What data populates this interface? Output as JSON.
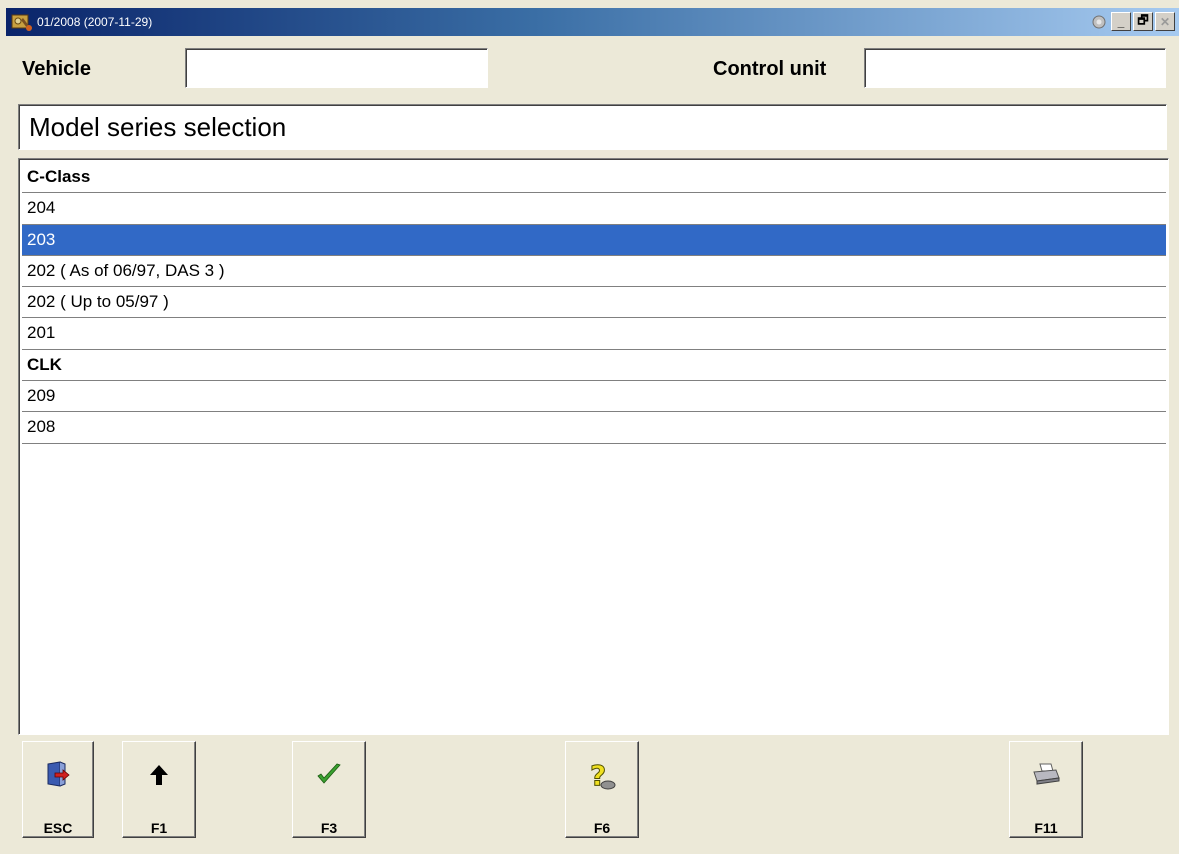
{
  "window": {
    "title": "01/2008 (2007-11-29)",
    "controls": {
      "minimize": "_",
      "restore": "🗗",
      "close": "✕"
    }
  },
  "header": {
    "vehicle_label": "Vehicle",
    "vehicle_value": "",
    "control_unit_label": "Control unit",
    "control_unit_value": ""
  },
  "section_title": "Model series selection",
  "list": {
    "items": [
      {
        "label": "C-Class",
        "type": "group"
      },
      {
        "label": "204",
        "type": "item"
      },
      {
        "label": "203",
        "type": "item",
        "selected": true
      },
      {
        "label": "202 ( As of 06/97, DAS 3 )",
        "type": "item"
      },
      {
        "label": "202 ( Up to 05/97 )",
        "type": "item"
      },
      {
        "label": "201",
        "type": "item"
      },
      {
        "label": "CLK",
        "type": "group"
      },
      {
        "label": "209",
        "type": "item"
      },
      {
        "label": "208",
        "type": "item"
      }
    ]
  },
  "footer": {
    "buttons": [
      {
        "key": "ESC",
        "icon": "exit-door-icon"
      },
      {
        "key": "F1",
        "icon": "arrow-up-icon"
      },
      {
        "key": "F3",
        "icon": "checkmark-icon"
      },
      {
        "key": "F6",
        "icon": "help-question-icon"
      },
      {
        "key": "F11",
        "icon": "printer-icon"
      }
    ]
  },
  "colors": {
    "selection": "#3169c6",
    "titlebar_start": "#0a246a",
    "titlebar_end": "#a6caf0",
    "face": "#ece9d8"
  }
}
